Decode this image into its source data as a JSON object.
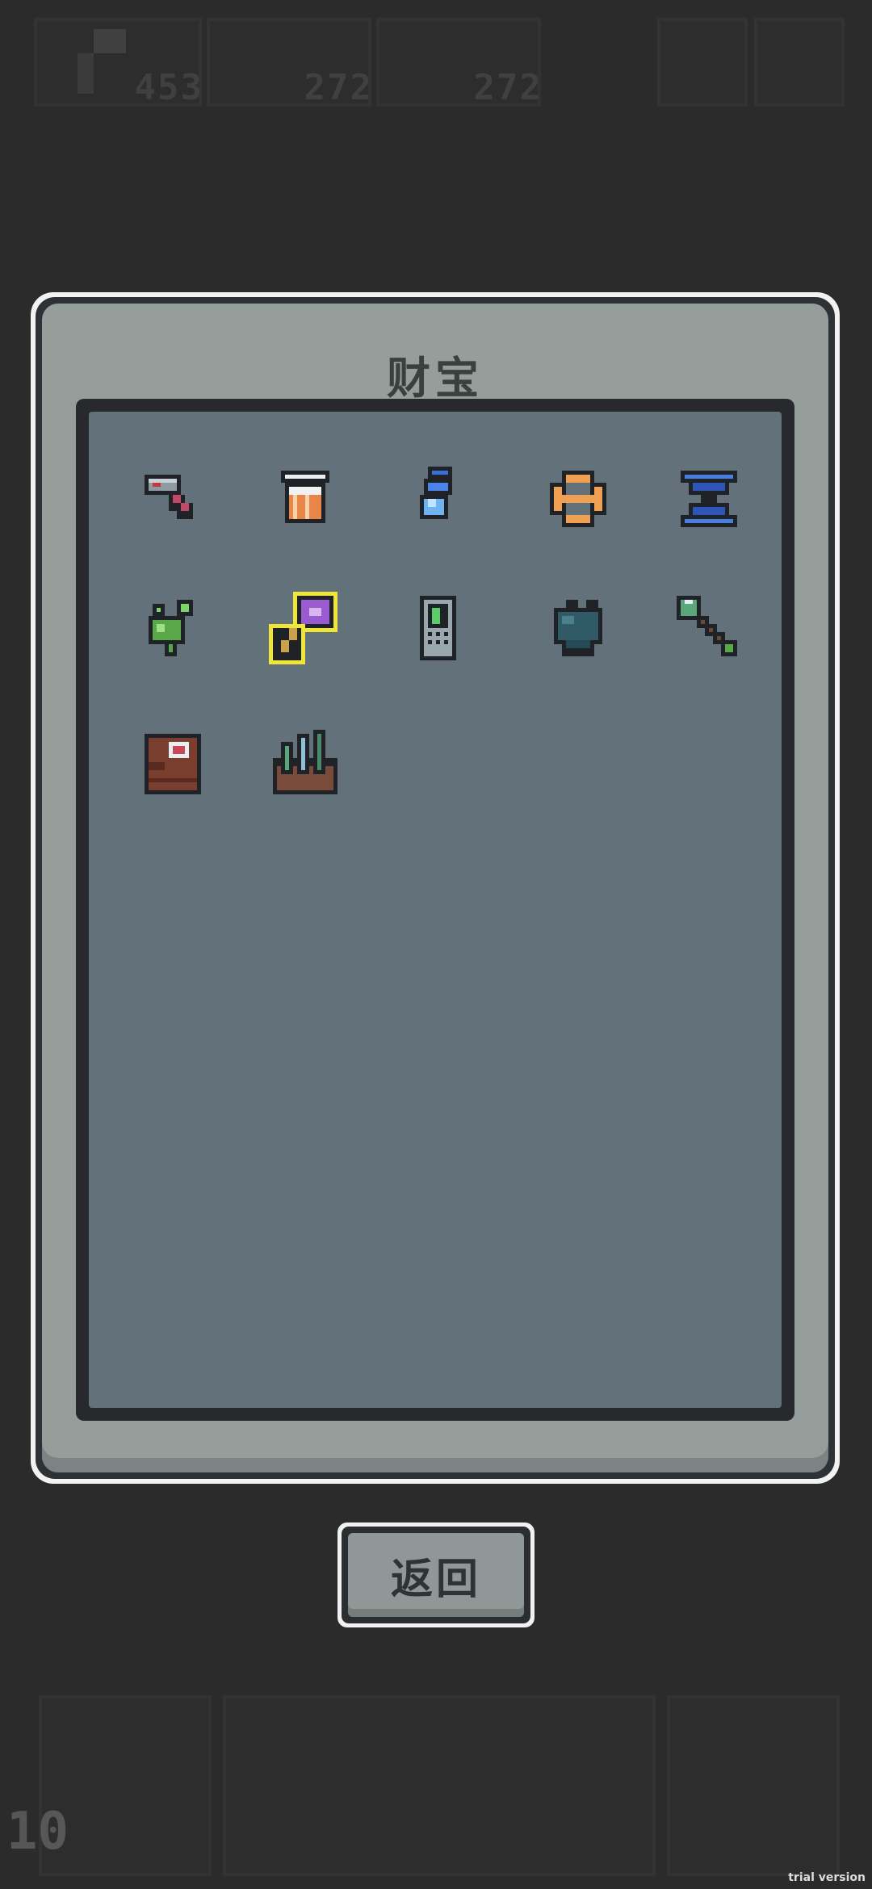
{
  "hud": {
    "resources": [
      {
        "icon": "hammer-resource-icon",
        "value": "453"
      },
      {
        "icon": "ore-resource-icon",
        "value": "272"
      },
      {
        "icon": "ore-resource-icon",
        "value": "272"
      }
    ],
    "level": "10"
  },
  "modal": {
    "title": "财宝",
    "items": [
      {
        "name": "hammer-icon",
        "selected": false
      },
      {
        "name": "lantern-icon",
        "selected": false
      },
      {
        "name": "blue-feather-icon",
        "selected": false
      },
      {
        "name": "orange-ring-icon",
        "selected": false
      },
      {
        "name": "hourglass-icon",
        "selected": false
      },
      {
        "name": "green-herb-icon",
        "selected": false
      },
      {
        "name": "purple-key-icon",
        "selected": true
      },
      {
        "name": "phone-device-icon",
        "selected": false
      },
      {
        "name": "dark-fin-icon",
        "selected": false
      },
      {
        "name": "green-arrow-icon",
        "selected": false
      },
      {
        "name": "brown-totem-icon",
        "selected": false
      },
      {
        "name": "crystal-rock-icon",
        "selected": false
      }
    ]
  },
  "back_button": {
    "label": "返回"
  },
  "watermark": "trial version",
  "colors": {
    "background": "#2b2b2b",
    "panel": "#62717a",
    "frame": "#959e9b",
    "selection": "#f0e63a"
  }
}
